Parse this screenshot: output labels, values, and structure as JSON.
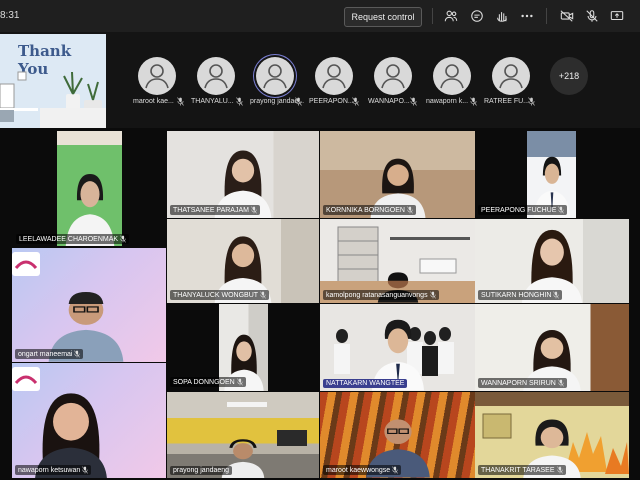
{
  "topbar": {
    "time": "8:31",
    "request_control_label": "Request control"
  },
  "slide": {
    "title": "Thank You"
  },
  "strip": {
    "participants": [
      {
        "name": "maroot kae..."
      },
      {
        "name": "THANYALU..."
      },
      {
        "name": "prayong jandae..."
      },
      {
        "name": "PEERAPON..."
      },
      {
        "name": "WANNAPO..."
      },
      {
        "name": "nawaporn k..."
      },
      {
        "name": "RATREE FU..."
      }
    ],
    "more_count": "+218"
  },
  "tiles": [
    {
      "name": "LEELAWADEE CHAROENMAK"
    },
    {
      "name": "THATSANEE PARAJAM"
    },
    {
      "name": "KORNNIKA BORNGOEN"
    },
    {
      "name": "PEERAPONG FUCHUE"
    },
    {
      "name": "THANYALUCK WONGBUT"
    },
    {
      "name": "kamolpong ratanasanguanvongs"
    },
    {
      "name": "SUTIKARN HONGHIN"
    },
    {
      "name": "ongart maneemai"
    },
    {
      "name": "SOPA DONNGOEN"
    },
    {
      "name": "NATTAKARN WANGTEE"
    },
    {
      "name": "WANNAPORN SRIRUN"
    },
    {
      "name": "nawaporn ketsuwan"
    },
    {
      "name": "prayong jandaeng"
    },
    {
      "name": "maroot kaewwongse"
    },
    {
      "name": "THANAKRIT TARASEE"
    }
  ]
}
